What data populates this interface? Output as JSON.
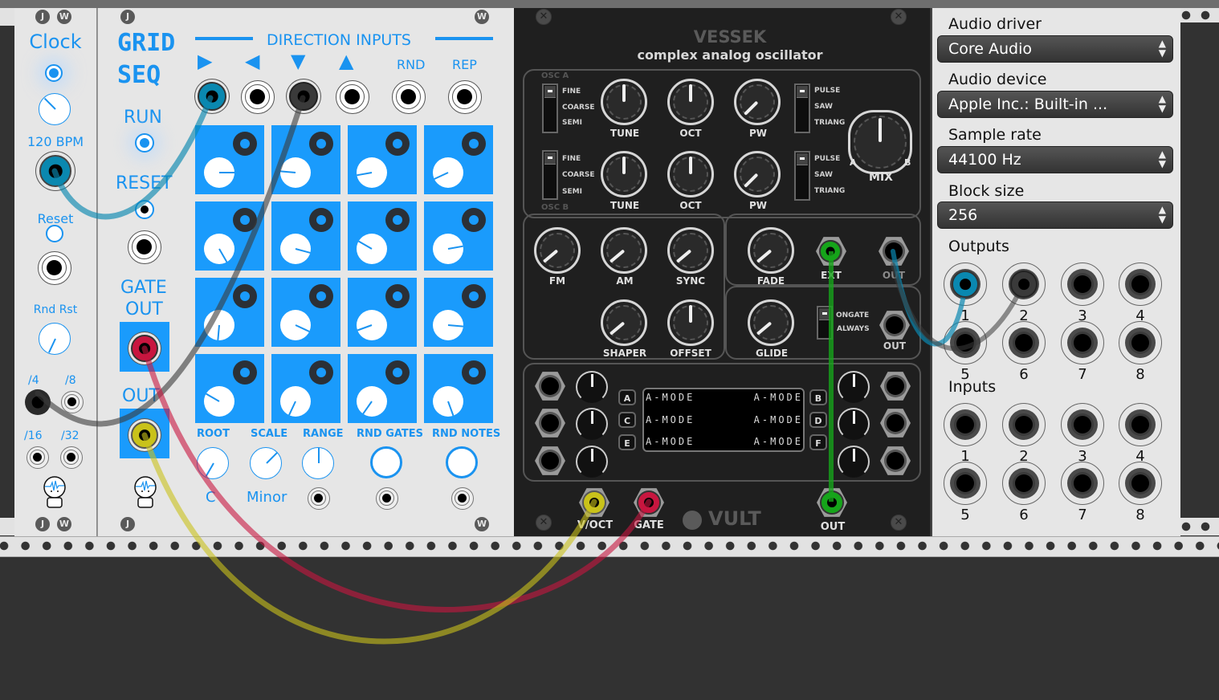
{
  "clock_module": {
    "title": "Clock",
    "bpm_label": "120 BPM",
    "reset_label": "Reset",
    "rnd_rst_label": "Rnd Rst",
    "dividers": [
      "/4",
      "/8",
      "/16",
      "/32"
    ],
    "screws": [
      "J",
      "W"
    ]
  },
  "grid_seq": {
    "title_line1": "GRID",
    "title_line2": "SEQ",
    "direction_inputs_label": "DIRECTION INPUTS",
    "direction_arrows": [
      "▶",
      "◀",
      "▼",
      "▲"
    ],
    "rnd_label": "RND",
    "rep_label": "REP",
    "run_label": "RUN",
    "reset_label": "RESET",
    "gate_out_label_1": "GATE",
    "gate_out_label_2": "OUT",
    "out_label": "OUT",
    "root_label": "ROOT",
    "scale_label": "SCALE",
    "range_label": "RANGE",
    "rnd_gates_label": "RND  GATES",
    "rnd_notes_label": "RND  NOTES",
    "root_value": "C",
    "scale_value": "Minor",
    "screws": [
      "J",
      "W"
    ],
    "step_knob_angles_deg": [
      270,
      95,
      80,
      65,
      330,
      285,
      120,
      260,
      5,
      295,
      70,
      275,
      120,
      25,
      35,
      340
    ]
  },
  "vessek": {
    "title": "VESSEK",
    "subtitle": "complex analog oscillator",
    "osc_a_label": "OSC A",
    "osc_b_label": "OSC B",
    "range_switch_options": [
      "FINE",
      "COARSE",
      "SEMI"
    ],
    "wave_switch_options": [
      "PULSE",
      "SAW",
      "TRIANG"
    ],
    "knob_labels": {
      "tune": "TUNE",
      "oct": "OCT",
      "pw": "PW",
      "mix": "MIX",
      "fm": "FM",
      "am": "AM",
      "sync": "SYNC",
      "shaper": "SHAPER",
      "offset": "OFFSET",
      "fade": "FADE",
      "glide": "GLIDE"
    },
    "mix_ends": [
      "A",
      "B"
    ],
    "ext_label": "EXT",
    "out_label": "OUT",
    "glide_switch_options": [
      "ONGATE",
      "ALWAYS"
    ],
    "mod_buttons": [
      "A",
      "B",
      "C",
      "D",
      "E",
      "F"
    ],
    "lcd_rows": [
      [
        "A-MODE",
        "A-MODE"
      ],
      [
        "A-MODE",
        "A-MODE"
      ],
      [
        "A-MODE",
        "A-MODE"
      ]
    ],
    "voct_label": "V/OCT",
    "gate_label": "GATE",
    "main_out_label": "OUT",
    "brand": "VULT"
  },
  "audio_interface": {
    "driver_label": "Audio driver",
    "driver_value": "Core Audio",
    "device_label": "Audio device",
    "device_value": "Apple Inc.: Built-in ...",
    "sample_rate_label": "Sample rate",
    "sample_rate_value": "44100 Hz",
    "block_size_label": "Block size",
    "block_size_value": "256",
    "outputs_label": "Outputs",
    "inputs_label": "Inputs",
    "channel_numbers": [
      "1",
      "2",
      "3",
      "4",
      "5",
      "6",
      "7",
      "8"
    ]
  },
  "cable_colors": {
    "blue": "#0a88b0",
    "dark": "#3a3a3a",
    "red": "#c8163f",
    "yellow": "#c9c21a",
    "green": "#16a41a"
  },
  "accent_color": "#1a93f0"
}
